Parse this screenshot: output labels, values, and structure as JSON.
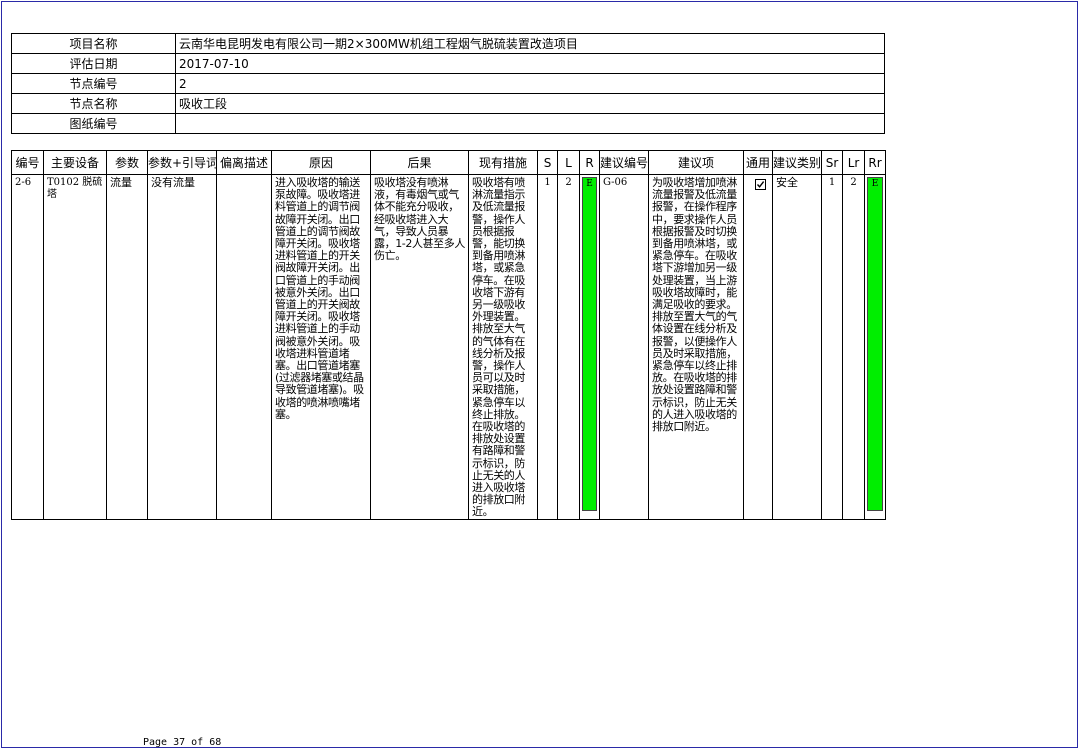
{
  "info": {
    "rows": [
      {
        "label": "项目名称",
        "value": "云南华电昆明发电有限公司一期2×300MW机组工程烟气脱硫装置改造项目"
      },
      {
        "label": "评估日期",
        "value": "2017-07-10"
      },
      {
        "label": "节点编号",
        "value": "2"
      },
      {
        "label": "节点名称",
        "value": "吸收工段"
      },
      {
        "label": "图纸编号",
        "value": ""
      }
    ]
  },
  "table": {
    "headers": [
      "编号",
      "主要设备",
      "参数",
      "参数+引导词",
      "偏离描述",
      "原因",
      "后果",
      "现有措施",
      "S",
      "L",
      "R",
      "建议编号",
      "建议项",
      "通用",
      "建议类别",
      "Sr",
      "Lr",
      "Rr"
    ],
    "row": {
      "id": "2-6",
      "equipment": "T0102 脱硫塔",
      "parameter": "流量",
      "guideword": "没有流量",
      "deviation": "",
      "cause": "进入吸收塔的输送泵故障。吸收塔进料管道上的调节阀故障开关闭。出口管道上的调节阀故障开关闭。吸收塔进料管道上的开关阀故障开关闭。出口管道上的手动阀被意外关闭。出口管道上的开关阀故障开关闭。吸收塔进料管道上的手动阀被意外关闭。吸收塔进料管道堵塞。出口管道堵塞(过滤器堵塞或结晶导致管道堵塞)。吸收塔的喷淋喷嘴堵塞。",
      "consequence": "吸收塔没有喷淋液，有毒烟气或气体不能充分吸收，经吸收塔进入大气，导致人员暴露，1-2人甚至多人伤亡。",
      "measures": "吸收塔有喷淋流量指示及低流量报警，操作人员根据报警，能切换到备用喷淋塔，或紧急停车。在吸收塔下游有另一级吸收外理装置。排放至大气的气体有在线分析及报警，操作人员可以及时采取措施，紧急停车以终止排放。在吸收塔的排放处设置有路障和警示标识，防止无关的人进入吸收塔的排放口附近。",
      "S": "1",
      "L": "2",
      "R": "E",
      "rec_no": "G-06",
      "recommendation": "为吸收塔增加喷淋流量报警及低流量报警，在操作程序中，要求操作人员根据报警及时切换到备用喷淋塔，或紧急停车。在吸收塔下游增加另一级处理装置，当上游吸收塔故障时，能满足吸收的要求。排放至置大气的气体设置在线分析及报警，以便操作人员及时采取措施，紧急停车以终止排放。在吸收塔的排放处设置路障和警示标识，防止无关的人进入吸收塔的排放口附近。",
      "general_checked": true,
      "category": "安全",
      "Sr": "1",
      "Lr": "2",
      "Rr": "E"
    }
  },
  "colors": {
    "risk_green": "#00ee00",
    "frame_border": "#2a2aa8"
  },
  "footer": {
    "page": "Page 37 of 68"
  }
}
